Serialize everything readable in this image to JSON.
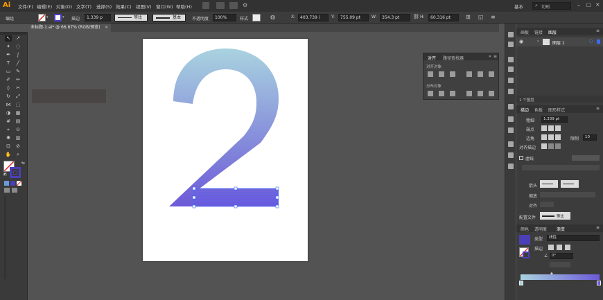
{
  "app": {
    "logo": "Ai"
  },
  "menubar": {
    "items": [
      "文件(F)",
      "编辑(E)",
      "对象(O)",
      "文字(T)",
      "选择(S)",
      "效果(C)",
      "视图(V)",
      "窗口(W)",
      "帮助(H)"
    ],
    "workspace": "基本",
    "search_placeholder": "切割"
  },
  "control_bar": {
    "selection_label": "编组",
    "stroke_label": "描边",
    "stroke_weight": "1.339 p",
    "stroke_profile": "等比",
    "brush_label": "基本",
    "opacity_label": "不透明度",
    "opacity_value": "100%",
    "style_label": "样式",
    "x_value": "403.739 i",
    "y_value": "755.09 pt",
    "w_value": "354.3 pt",
    "h_value": "60.316 pt"
  },
  "document_tab": {
    "title": "未标题-1.ai* @ 66.67% (RGB/预览)"
  },
  "align_panel": {
    "tabs": [
      "对齐",
      "路径查找器"
    ],
    "align_objects_label": "对齐对象",
    "distribute_objects_label": "分布对象"
  },
  "layers_panel": {
    "tabs": [
      "画板",
      "链接",
      "图层"
    ],
    "layer_name": "图层 1",
    "footer": "1 个图层"
  },
  "stroke_panel": {
    "tabs": [
      "描边",
      "色板",
      "图形样式"
    ],
    "weight_label": "粗细",
    "weight_value": "1.339 pt",
    "cap_label": "端点",
    "corner_label": "边角",
    "limit_label": "限制",
    "limit_value": "10",
    "align_label": "对齐描边",
    "dashed_label": "虚线",
    "arrow_label": "箭头",
    "scale_label": "缩放",
    "align_arrow_label": "对齐",
    "profile_label": "配置文件",
    "profile_value": "等比"
  },
  "gradient_panel": {
    "tabs": [
      "颜色",
      "透明度",
      "渐变"
    ],
    "type_label": "类型",
    "type_value": "线性",
    "stroke_label": "描边",
    "angle_value": "0°"
  },
  "colors": {
    "gradient_start": "#a9d3df",
    "gradient_end": "#6c5ad8",
    "selection_blue": "#3a6cff",
    "fill_swatch": "#4b3fb8"
  }
}
